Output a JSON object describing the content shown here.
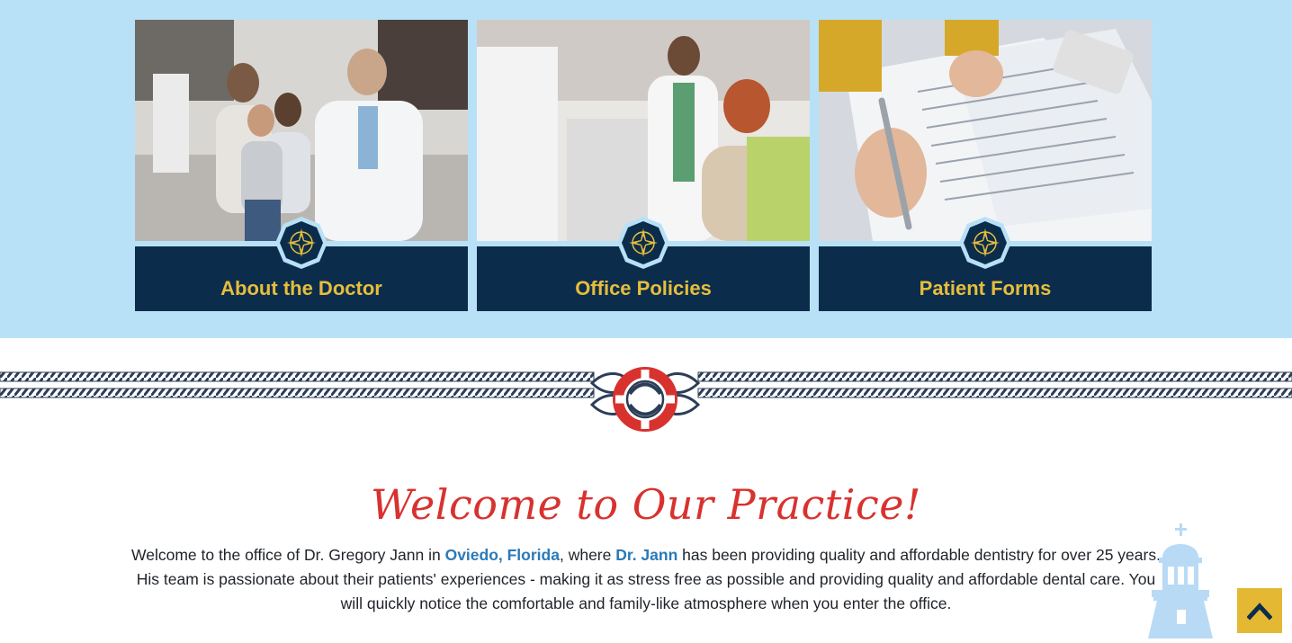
{
  "cards": [
    {
      "label": "About the Doctor",
      "photo_icon": "doctor-family-photo",
      "badge_icon": "compass-icon"
    },
    {
      "label": "Office Policies",
      "photo_icon": "dental-office-photo",
      "badge_icon": "compass-icon"
    },
    {
      "label": "Patient Forms",
      "photo_icon": "forms-writing-photo",
      "badge_icon": "compass-icon"
    }
  ],
  "divider": {
    "icon": "life-ring-icon"
  },
  "welcome": {
    "title": "Welcome to Our Practice!",
    "intro": {
      "part1": "Welcome to the office of Dr. Gregory Jann in ",
      "link1": "Oviedo, Florida",
      "part2": ", where ",
      "link2": "Dr. Jann",
      "part3": " has been providing quality and affordable dentistry for over 25 years. His team is passionate about their patients' experiences - making it as stress free as possible and providing quality and affordable dental care. You will quickly notice the comfortable and family-like atmosphere when you enter the office."
    }
  },
  "decor": {
    "lighthouse_icon": "lighthouse-icon"
  },
  "back_to_top": {
    "icon": "chevron-up-icon"
  },
  "colors": {
    "band_bg": "#b8e1f8",
    "card_bg": "#0b2d4b",
    "card_label": "#e7bd3c",
    "title_red": "#d8322f",
    "link_blue": "#2a7ab8",
    "back_top_bg": "#e4b833"
  }
}
